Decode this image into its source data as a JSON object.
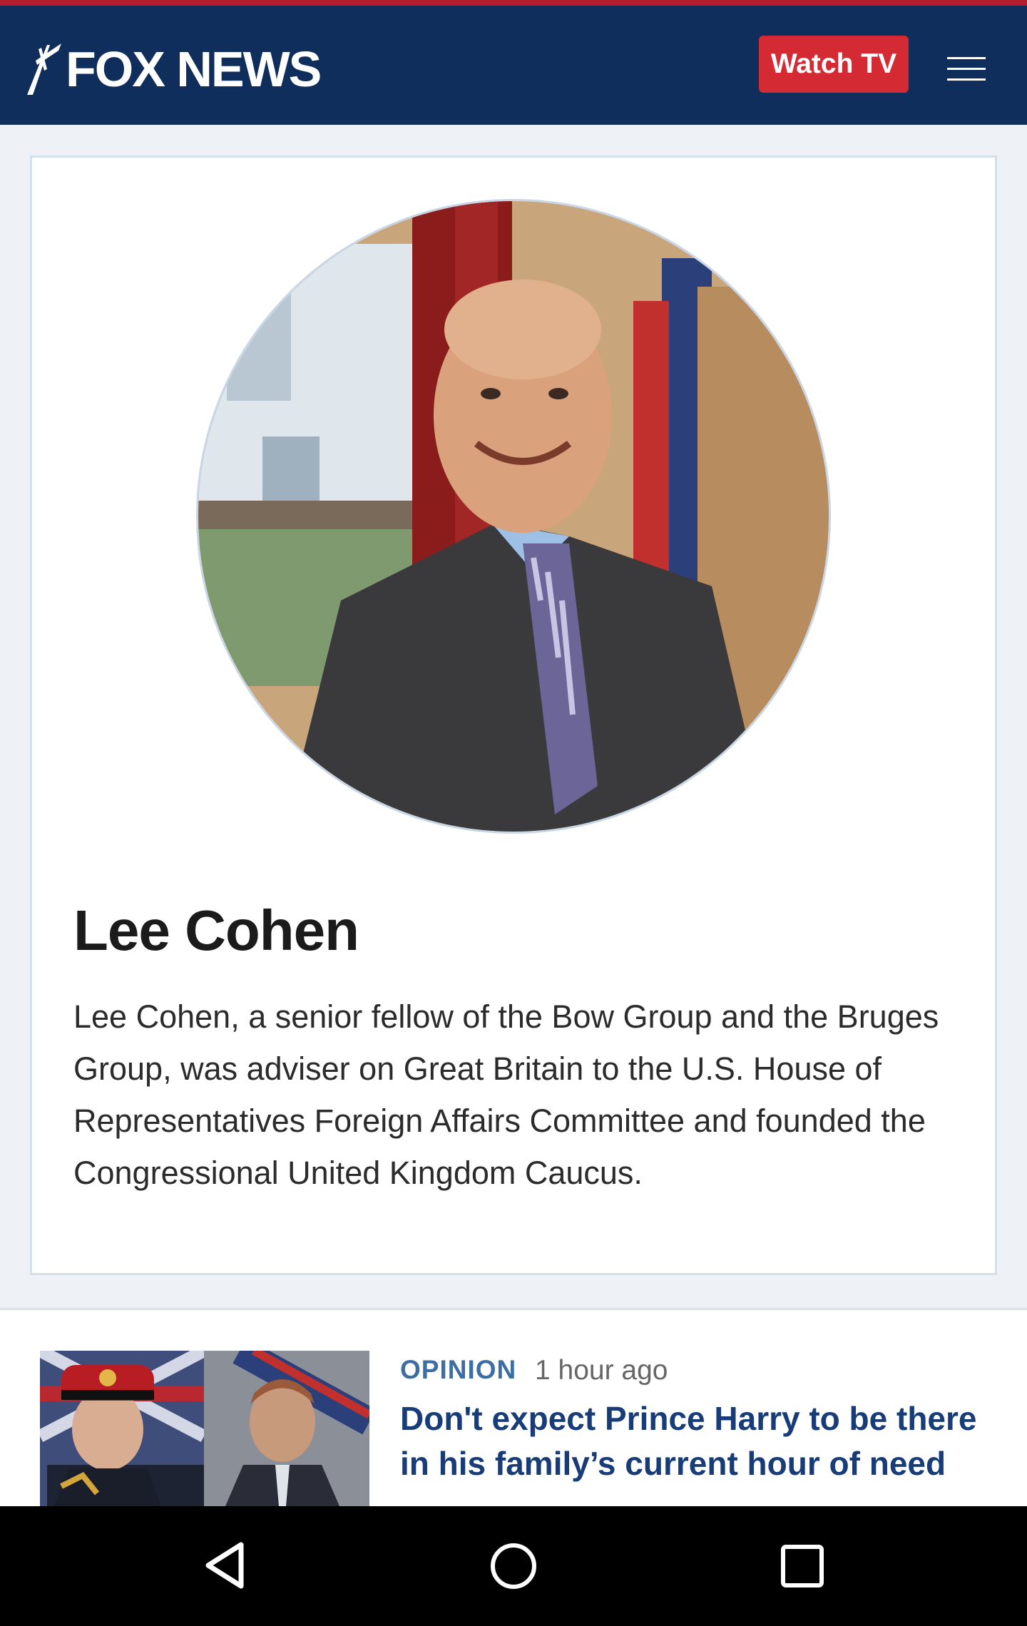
{
  "header": {
    "brand": "FOX NEWS",
    "watch_label": "Watch TV",
    "menu_icon": "hamburger-menu-icon",
    "colors": {
      "bar": "#0f2e5c",
      "accent": "#d42a34",
      "top_line": "#b41e2c"
    }
  },
  "author": {
    "name": "Lee Cohen",
    "bio": "Lee Cohen, a senior fellow of the Bow Group and the Bruges Group, was adviser on Great Britain to the U.S. House of Representatives Foreign Affairs Committee and founded the Congressional United Kingdom Caucus."
  },
  "article": {
    "category": "OPINION",
    "time": "1 hour ago",
    "headline": "Don't expect Prince Harry to be there in his family’s current hour of need"
  },
  "navbar": {
    "back_icon": "back-triangle-icon",
    "home_icon": "home-circle-icon",
    "recents_icon": "recents-square-icon"
  }
}
